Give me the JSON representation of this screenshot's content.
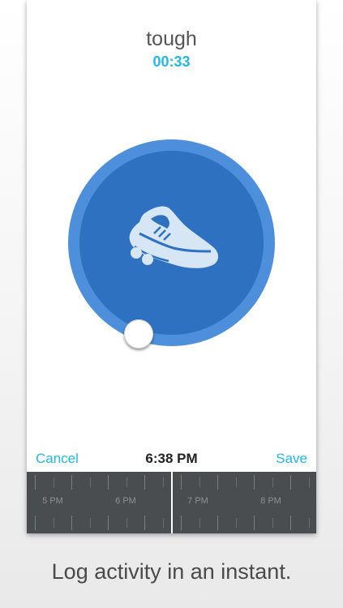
{
  "header": {
    "intensity": "tough",
    "duration": "00:33"
  },
  "activity": {
    "icon": "shoe-icon",
    "dial_outer_color": "#4d8fda",
    "dial_inner_color": "#2f71c1",
    "icon_color": "#d6e6f5"
  },
  "actions": {
    "cancel_label": "Cancel",
    "time": "6:38 PM",
    "save_label": "Save",
    "accent_color": "#21b7e6"
  },
  "timeline": {
    "hours": [
      "5 PM",
      "6 PM",
      "7 PM",
      "8 PM"
    ]
  },
  "caption": "Log activity in an instant."
}
